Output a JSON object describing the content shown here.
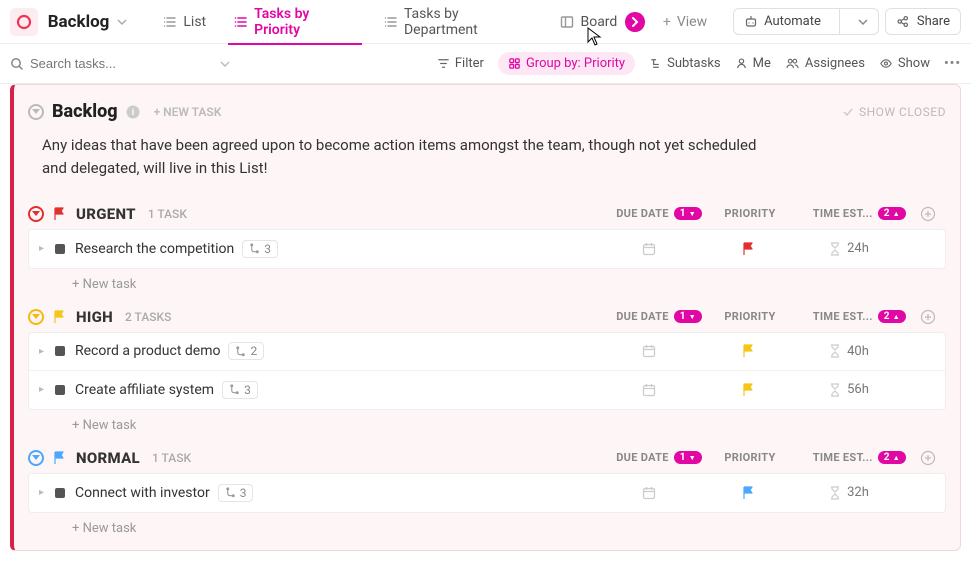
{
  "header": {
    "title": "Backlog",
    "views": {
      "list": "List",
      "tasks_by_priority": "Tasks by Priority",
      "tasks_by_department": "Tasks by Department",
      "board": "Board",
      "add_view": "View"
    },
    "automate": "Automate",
    "share": "Share"
  },
  "toolbar": {
    "search_placeholder": "Search tasks...",
    "filter": "Filter",
    "group_by": "Group by: Priority",
    "subtasks": "Subtasks",
    "me": "Me",
    "assignees": "Assignees",
    "show": "Show"
  },
  "list": {
    "title": "Backlog",
    "new_task_top": "+ NEW TASK",
    "show_closed": "SHOW CLOSED",
    "description": "Any ideas that have been agreed upon to become action items amongst the team, though not yet scheduled and delegated, will live in this List!",
    "columns": {
      "due": "DUE DATE",
      "due_badge": "1",
      "priority": "PRIORITY",
      "est": "TIME EST...",
      "est_badge": "2"
    },
    "new_task_label": "+ New task",
    "groups": [
      {
        "key": "urgent",
        "name": "URGENT",
        "count": "1 TASK",
        "color": "#e03030",
        "flag_color": "#e03030",
        "tasks": [
          {
            "name": "Research the competition",
            "subtasks": "3",
            "estimate": "24h"
          }
        ]
      },
      {
        "key": "high",
        "name": "HIGH",
        "count": "2 TASKS",
        "color": "#f5b90a",
        "flag_color": "#f5c518",
        "tasks": [
          {
            "name": "Record a product demo",
            "subtasks": "2",
            "estimate": "40h"
          },
          {
            "name": "Create affiliate system",
            "subtasks": "3",
            "estimate": "56h"
          }
        ]
      },
      {
        "key": "normal",
        "name": "NORMAL",
        "count": "1 TASK",
        "color": "#4aa8ff",
        "flag_color": "#4aa8ff",
        "tasks": [
          {
            "name": "Connect with investor",
            "subtasks": "3",
            "estimate": "32h"
          }
        ]
      }
    ]
  }
}
